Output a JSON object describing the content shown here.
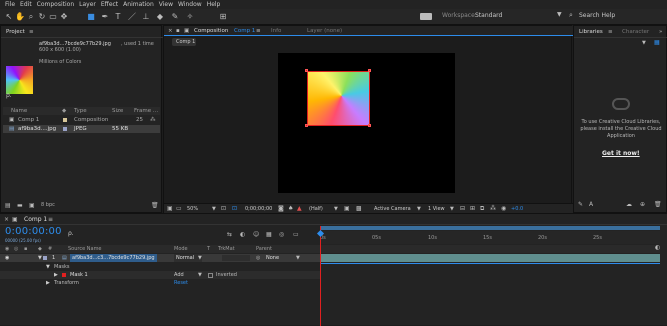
{
  "menu": [
    "File",
    "Edit",
    "Composition",
    "Layer",
    "Effect",
    "Animation",
    "View",
    "Window",
    "Help"
  ],
  "toolbar": {
    "workspace_label": "Workspace:",
    "workspace_value": "Standard",
    "search_placeholder": "Search Help"
  },
  "project": {
    "tab_label": "Project",
    "file_name": "af9ba3d...7bcde9c77b29.jpg",
    "used_text": ", used 1 time",
    "dimensions": "600 x 600 (1.00)",
    "colors": "Millions of Colors",
    "search_glyph": "ρ.",
    "columns": {
      "name": "Name",
      "type": "Type",
      "size": "Size",
      "frame": "Frame ..."
    },
    "items": [
      {
        "name": "Comp 1",
        "type": "Composition",
        "size": "",
        "frame": "25",
        "selected": false
      },
      {
        "name": "af9ba3d....jpg",
        "type": "JPEG",
        "size": "55 KB",
        "frame": "",
        "selected": true
      }
    ],
    "bpc": "8 bpc"
  },
  "composition": {
    "tabs": [
      {
        "label": "Composition",
        "suffix": "Comp 1"
      },
      {
        "label": "Info"
      },
      {
        "label": "Layer  (none)"
      }
    ],
    "active_comp_tab": "Comp 1",
    "footer": {
      "zoom": "50%",
      "timecode": "0;00;00;00",
      "resolution": "(Half)",
      "camera": "Active Camera",
      "views": "1 View",
      "exposure": "+0.0"
    }
  },
  "libraries": {
    "tabs": [
      "Libraries",
      "Character"
    ],
    "message": "To use Creative Cloud Libraries, please install the Creative Cloud Application",
    "cta": "Get it now!",
    "footer_glyph": "A"
  },
  "timeline": {
    "tab_label": "Comp 1",
    "timecode": "0:00:00:00",
    "timecode_sub": "00000 (25.00 fps)",
    "search_glyph": "ρ.",
    "columns": {
      "source": "Source Name",
      "mode": "Mode",
      "t": "T",
      "trkmat": "TrkMat",
      "parent": "Parent"
    },
    "layer": {
      "index": "1",
      "name": "af9ba3d...c3...7bcde9c77b29.jpg",
      "mode": "Normal",
      "parent": "None"
    },
    "masks_label": "Masks",
    "mask_name": "Mask 1",
    "mask_mode": "Add",
    "mask_inverted": "Inverted",
    "transform_label": "Transform",
    "transform_value": "Reset",
    "ruler": [
      "0s",
      "05s",
      "10s",
      "15s",
      "20s",
      "25s"
    ]
  },
  "colors": {
    "accent": "#2d8ceb",
    "mask_red": "#e02020",
    "layer_bar": "#5f8e8e",
    "work_area": "#3a6f9d"
  }
}
